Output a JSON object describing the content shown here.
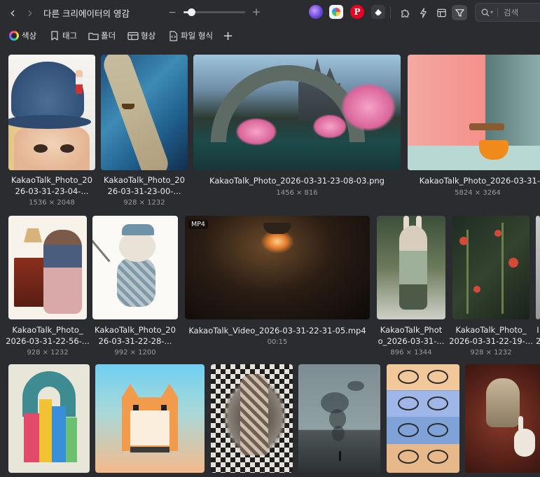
{
  "topbar": {
    "back_glyph": "‹",
    "forward_glyph": "›",
    "title": "다른 크리에이터의 영감",
    "zoom_minus": "−",
    "zoom_plus": "+",
    "zoom_level": 0.13,
    "extensions": [
      "browser-extension-icon",
      "color-palette-extension-icon",
      "pinterest-icon",
      "eraser-extension-icon"
    ],
    "tools": [
      "plugin-icon",
      "lightning-icon",
      "layout-panel-icon",
      "filter-icon"
    ],
    "search_placeholder": "검색"
  },
  "filters": {
    "items": [
      {
        "label": "색상",
        "icon": "color-wheel-icon"
      },
      {
        "label": "태그",
        "icon": "tag-icon"
      },
      {
        "label": "폴더",
        "icon": "folder-icon"
      },
      {
        "label": "형상",
        "icon": "shape-icon"
      },
      {
        "label": "파일 형식",
        "icon": "file-type-icon"
      }
    ],
    "add_glyph": "+"
  },
  "items": [
    {
      "line1": "KakaoTalk_Photo_20",
      "line2": "26-03-31-23-04-...",
      "dims": "1536 × 2048",
      "art": "hat"
    },
    {
      "line1": "KakaoTalk_Photo_20",
      "line2": "26-03-31-23-00-...",
      "dims": "928 × 1232",
      "art": "river"
    },
    {
      "line1": "KakaoTalk_Photo_2026-03-31-23-08-03.png",
      "line2": "",
      "dims": "1456 × 816",
      "art": "bridge"
    },
    {
      "line1": "KakaoTalk_Photo_2026-03-31-",
      "line2": "",
      "dims": "5824 × 3264",
      "art": "cup"
    },
    {
      "line1": "KakaoTalk_Photo_",
      "line2": "2026-03-31-22-56-...",
      "dims": "928 × 1232",
      "art": "desk"
    },
    {
      "line1": "KakaoTalk_Photo_20",
      "line2": "26-03-31-22-28-...",
      "dims": "992 × 1200",
      "art": "bear"
    },
    {
      "line1": "KakaoTalk_Video_2026-03-31-22-31-05.mp4",
      "line2": "",
      "dims": "00:15",
      "art": "video",
      "badge": "MP4"
    },
    {
      "line1": "KakaoTalk_Phot",
      "line2": "o_2026-03-31-...",
      "dims": "896 × 1344",
      "art": "rabbit"
    },
    {
      "line1": "KakaoTalk_Photo_",
      "line2": "2026-03-31-22-19-...",
      "dims": "928 × 1232",
      "art": "floral"
    },
    {
      "line1": "I",
      "line2": "2",
      "dims": "",
      "art": "edge"
    },
    {
      "line1": "",
      "line2": "",
      "dims": "",
      "art": "city"
    },
    {
      "line1": "",
      "line2": "",
      "dims": "",
      "art": "cat"
    },
    {
      "line1": "",
      "line2": "",
      "dims": "",
      "art": "checker"
    },
    {
      "line1": "",
      "line2": "",
      "dims": "",
      "art": "smoke"
    },
    {
      "line1": "",
      "line2": "",
      "dims": "",
      "art": "anime"
    },
    {
      "line1": "",
      "line2": "",
      "dims": "",
      "art": "knight"
    }
  ]
}
